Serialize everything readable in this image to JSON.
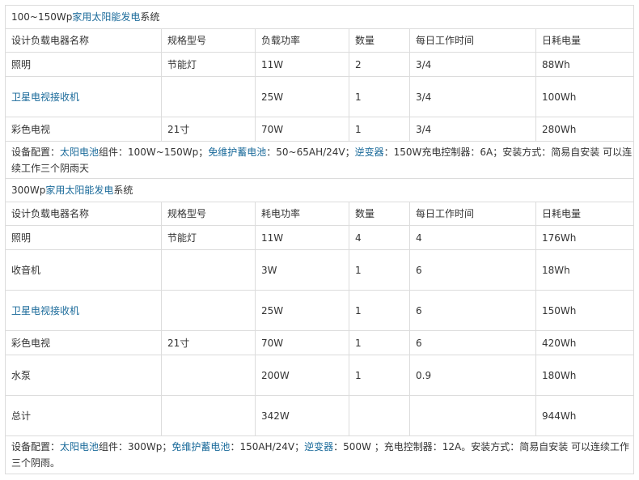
{
  "section1": {
    "title_pre": "100~150Wp",
    "title_link": "家用太阳能发电",
    "title_post": "系统",
    "headers": [
      "设计负载电器名称",
      "规格型号",
      "负载功率",
      "数量",
      "每日工作时间",
      "日耗电量"
    ],
    "rows": [
      {
        "name": "照明",
        "name_is_link": false,
        "model": "节能灯",
        "power": "11W",
        "qty": "2",
        "hours": "3/4",
        "energy": "88Wh"
      },
      {
        "name": "卫星电视接收机",
        "name_is_link": true,
        "model": "",
        "power": "25W",
        "qty": "1",
        "hours": "3/4",
        "energy": "100Wh"
      },
      {
        "name": "彩色电视",
        "name_is_link": false,
        "model": "21寸",
        "power": "70W",
        "qty": "1",
        "hours": "3/4",
        "energy": "280Wh"
      }
    ],
    "config": {
      "p1": "设备配置：",
      "l1": "太阳电池",
      "p2": "组件：100W~150Wp；",
      "l2": "免维护蓄电池",
      "p3": "：50~65AH/24V；",
      "l3": "逆变器",
      "p4": "：150W充电控制器：6A；安装方式：简易自安装 可以连续工作三个阴雨天"
    }
  },
  "section2": {
    "title_pre": "300Wp",
    "title_link": "家用太阳能发电",
    "title_post": "系统",
    "headers": [
      "设计负载电器名称",
      "规格型号",
      "耗电功率",
      "数量",
      "每日工作时间",
      "日耗电量"
    ],
    "rows": [
      {
        "name": "照明",
        "name_is_link": false,
        "model": "节能灯",
        "power": "11W",
        "qty": "4",
        "hours": "4",
        "energy": "176Wh"
      },
      {
        "name": "收音机",
        "name_is_link": false,
        "model": "",
        "power": "3W",
        "qty": "1",
        "hours": "6",
        "energy": "18Wh"
      },
      {
        "name": "卫星电视接收机",
        "name_is_link": true,
        "model": "",
        "power": "25W",
        "qty": "1",
        "hours": "6",
        "energy": "150Wh"
      },
      {
        "name": "彩色电视",
        "name_is_link": false,
        "model": "21寸",
        "power": "70W",
        "qty": "1",
        "hours": "6",
        "energy": "420Wh"
      },
      {
        "name": "水泵",
        "name_is_link": false,
        "model": "",
        "power": "200W",
        "qty": "1",
        "hours": "0.9",
        "energy": "180Wh"
      },
      {
        "name": "总计",
        "name_is_link": false,
        "model": "",
        "power": "342W",
        "qty": "",
        "hours": "",
        "energy": "944Wh"
      }
    ],
    "config": {
      "p1": "设备配置：",
      "l1": "太阳电池",
      "p2": "组件：300Wp；",
      "l2": "免维护蓄电池",
      "p3": "：150AH/24V；",
      "l3": "逆变器",
      "p4": "：500W ；充电控制器：12A。安装方式：简易自安装 可以连续工作三个阴雨。"
    }
  },
  "colors": {
    "link": "#1a6a9a",
    "text": "#333333",
    "border": "#dcdcdc"
  }
}
